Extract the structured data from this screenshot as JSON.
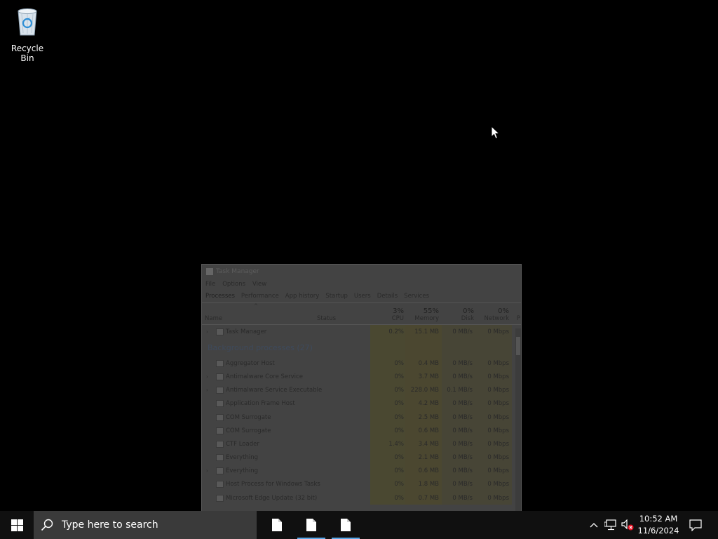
{
  "desktop": {
    "recycle_bin_label": "Recycle Bin"
  },
  "task_manager": {
    "title": "Task Manager",
    "menu": [
      "File",
      "Options",
      "View"
    ],
    "tabs": [
      "Processes",
      "Performance",
      "App history",
      "Startup",
      "Users",
      "Details",
      "Services"
    ],
    "columns": {
      "name": "Name",
      "status": "Status",
      "cpu": {
        "label": "CPU",
        "pct": "3%"
      },
      "memory": {
        "label": "Memory",
        "pct": "55%"
      },
      "disk": {
        "label": "Disk",
        "pct": "0%"
      },
      "network": {
        "label": "Network",
        "pct": "0%"
      },
      "extra": "P"
    },
    "app_row": {
      "name": "Task Manager",
      "cpu": "0.2%",
      "memory": "15.1 MB",
      "disk": "0 MB/s",
      "network": "0 Mbps"
    },
    "group_label": "Background processes (27)",
    "rows": [
      {
        "name": "Aggregator Host",
        "cpu": "0%",
        "memory": "0.4 MB",
        "disk": "0 MB/s",
        "network": "0 Mbps",
        "expand": false
      },
      {
        "name": "Antimalware Core Service",
        "cpu": "0%",
        "memory": "3.7 MB",
        "disk": "0 MB/s",
        "network": "0 Mbps",
        "expand": true
      },
      {
        "name": "Antimalware Service Executable",
        "cpu": "0%",
        "memory": "228.0 MB",
        "disk": "0.1 MB/s",
        "network": "0 Mbps",
        "expand": true
      },
      {
        "name": "Application Frame Host",
        "cpu": "0%",
        "memory": "4.2 MB",
        "disk": "0 MB/s",
        "network": "0 Mbps",
        "expand": false
      },
      {
        "name": "COM Surrogate",
        "cpu": "0%",
        "memory": "2.5 MB",
        "disk": "0 MB/s",
        "network": "0 Mbps",
        "expand": false
      },
      {
        "name": "COM Surrogate",
        "cpu": "0%",
        "memory": "0.6 MB",
        "disk": "0 MB/s",
        "network": "0 Mbps",
        "expand": false
      },
      {
        "name": "CTF Loader",
        "cpu": "1.4%",
        "memory": "3.4 MB",
        "disk": "0 MB/s",
        "network": "0 Mbps",
        "expand": false
      },
      {
        "name": "Everything",
        "cpu": "0%",
        "memory": "2.1 MB",
        "disk": "0 MB/s",
        "network": "0 Mbps",
        "expand": false
      },
      {
        "name": "Everything",
        "cpu": "0%",
        "memory": "0.6 MB",
        "disk": "0 MB/s",
        "network": "0 Mbps",
        "expand": true
      },
      {
        "name": "Host Process for Windows Tasks",
        "cpu": "0%",
        "memory": "1.8 MB",
        "disk": "0 MB/s",
        "network": "0 Mbps",
        "expand": false
      },
      {
        "name": "Microsoft Edge Update (32 bit)",
        "cpu": "0%",
        "memory": "0.7 MB",
        "disk": "0 MB/s",
        "network": "0 Mbps",
        "expand": false
      }
    ]
  },
  "taskbar": {
    "search_placeholder": "Type here to search",
    "apps": [
      {
        "icon": "document-icon",
        "active": false
      },
      {
        "icon": "document-icon",
        "active": true
      },
      {
        "icon": "document-icon",
        "active": true
      }
    ],
    "clock": {
      "time": "10:52 AM",
      "date": "11/6/2024"
    }
  }
}
